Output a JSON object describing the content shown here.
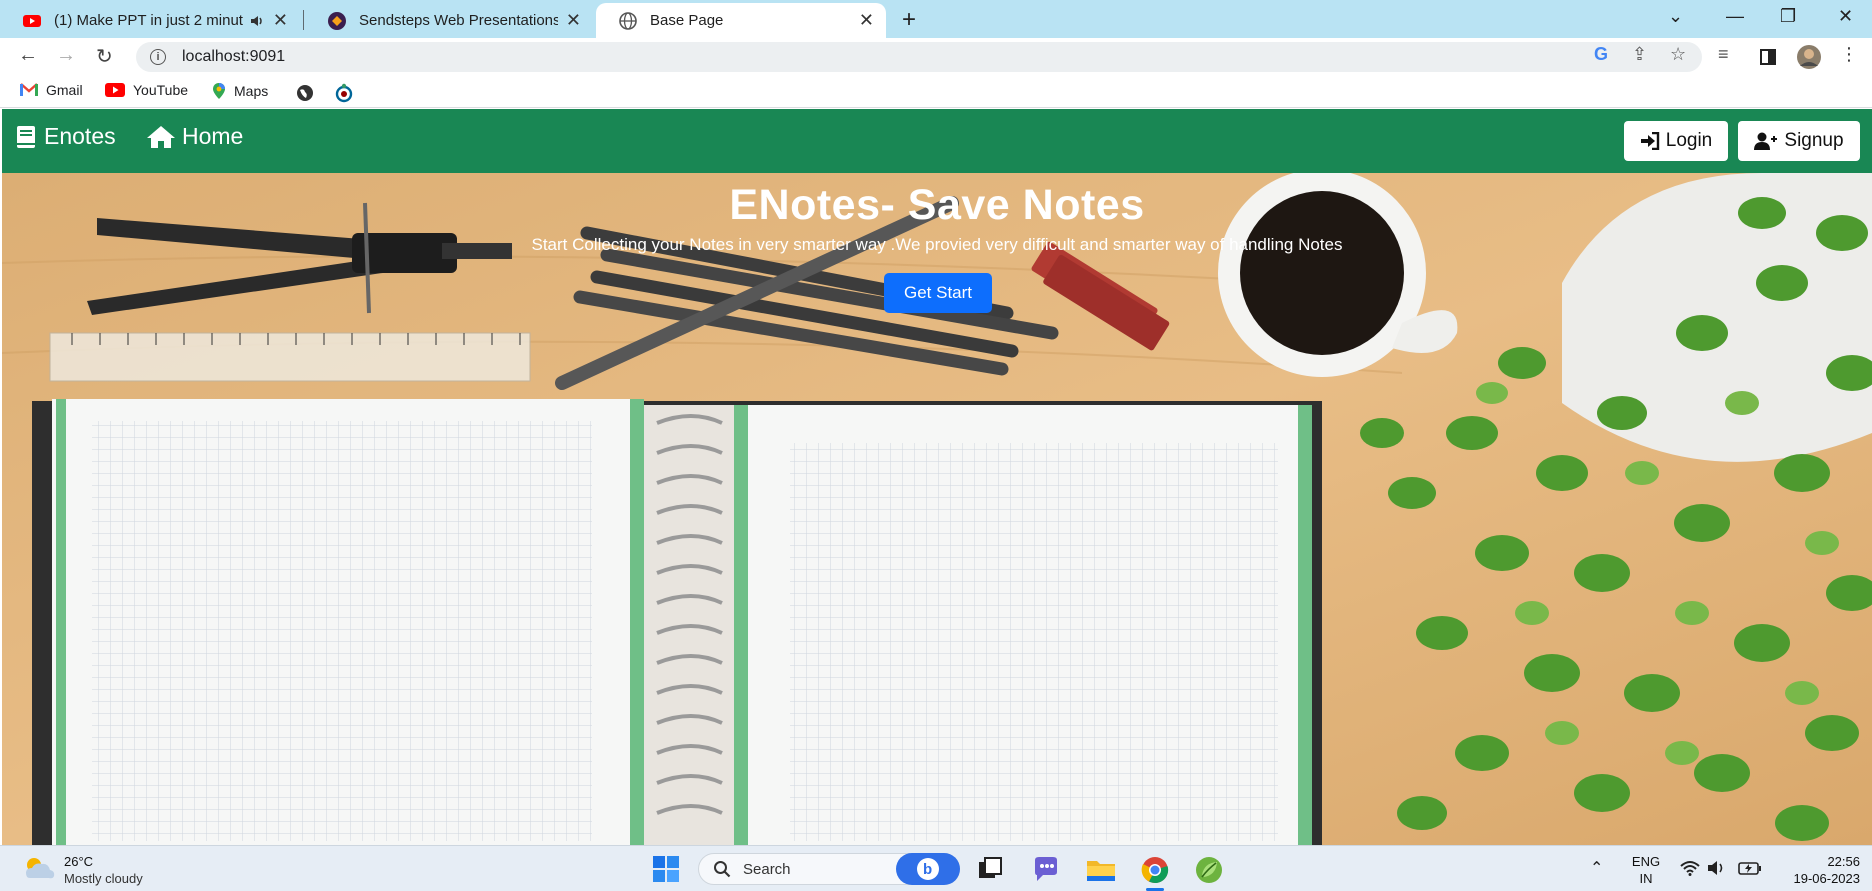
{
  "browser": {
    "tabs": [
      {
        "title": "(1) Make PPT in just 2 minute",
        "favicon": "youtube-icon",
        "audio": true
      },
      {
        "title": "Sendsteps Web Presentations",
        "favicon": "sendsteps-icon"
      },
      {
        "title": "Base Page",
        "favicon": "globe-icon",
        "active": true
      }
    ],
    "address": "localhost:9091",
    "bookmarks": [
      {
        "label": "Gmail",
        "icon": "gmail-icon"
      },
      {
        "label": "YouTube",
        "icon": "youtube-icon"
      },
      {
        "label": "Maps",
        "icon": "maps-icon"
      }
    ]
  },
  "navbar": {
    "brand": "Enotes",
    "home": "Home",
    "login": "Login",
    "signup": "Signup",
    "color": "#198754"
  },
  "hero": {
    "title": "ENotes- Save Notes",
    "subtitle": "Start Collecting your Notes in very smarter way .We provied very difficult and smarter way of handling Notes",
    "cta": "Get Start",
    "cta_color": "#0d6efd"
  },
  "taskbar": {
    "weather_temp": "26°C",
    "weather_desc": "Mostly cloudy",
    "search": "Search",
    "lang_top": "ENG",
    "lang_bottom": "IN",
    "time": "22:56",
    "date": "19-06-2023"
  }
}
